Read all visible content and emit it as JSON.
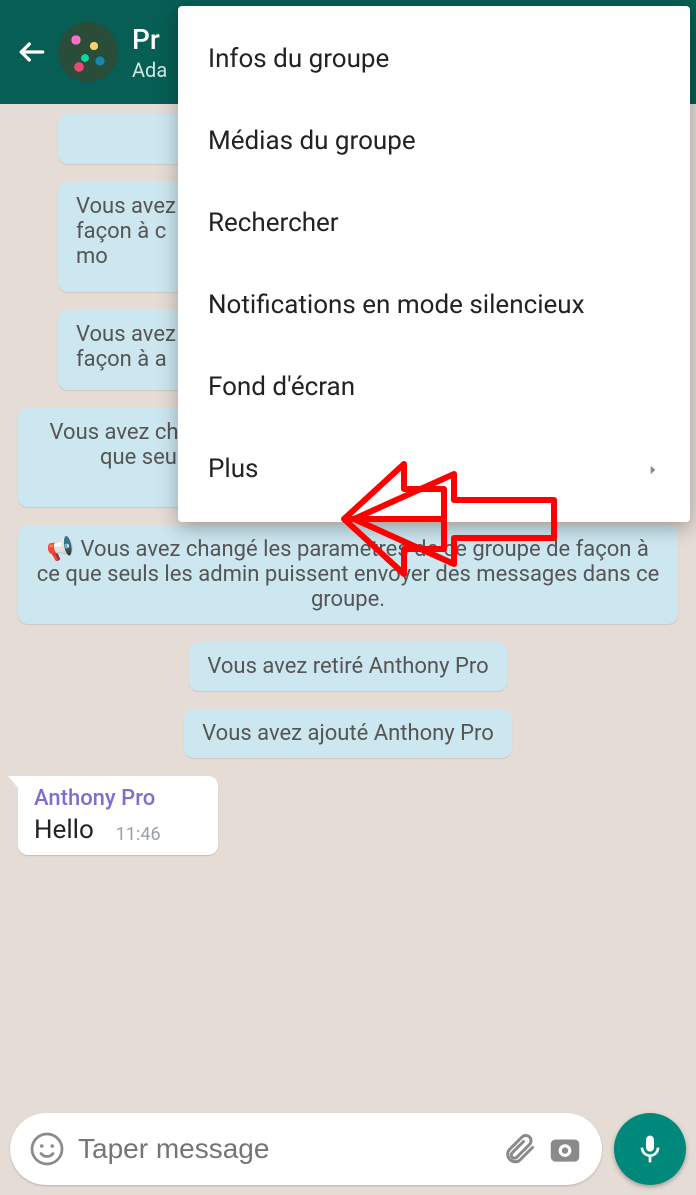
{
  "header": {
    "title_visible": "Pr",
    "subtitle_visible": "Ada"
  },
  "menu": {
    "items": [
      {
        "label": "Infos du groupe",
        "has_chevron": false
      },
      {
        "label": "Médias du groupe",
        "has_chevron": false
      },
      {
        "label": "Rechercher",
        "has_chevron": false
      },
      {
        "label": "Notifications en mode silencieux",
        "has_chevron": false
      },
      {
        "label": "Fond d'écran",
        "has_chevron": false
      },
      {
        "label": "Plus",
        "has_chevron": true
      }
    ]
  },
  "system_messages": {
    "partial1": "Vous avez\nfaçon à c\nmo",
    "partial2": "Vous avez\nfaçon à a",
    "settings_info": "Vous avez changé les paramètres de ce groupe de façon à ce que seuls les administrateurs puissent modifier les informations du groupe",
    "settings_send": "Vous avez changé les paramètres de ce groupe de façon à ce que seuls les admin puissent envoyer des messages dans ce groupe.",
    "removed": "Vous avez retiré Anthony Pro",
    "added": "Vous avez ajouté Anthony Pro"
  },
  "message": {
    "sender": "Anthony Pro",
    "body": "Hello",
    "time": "11:46"
  },
  "input": {
    "placeholder": "Taper message"
  }
}
